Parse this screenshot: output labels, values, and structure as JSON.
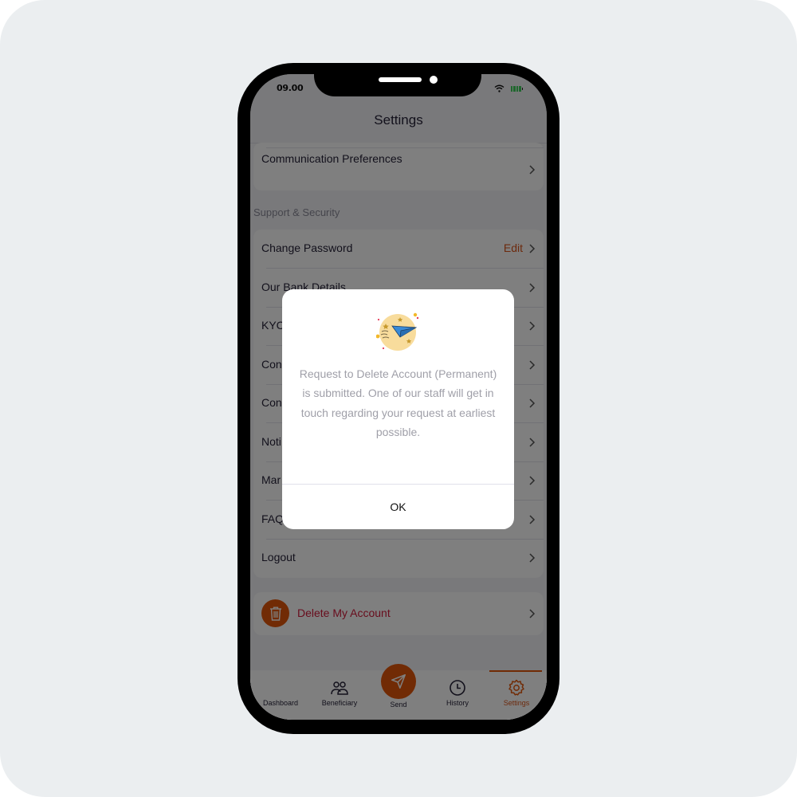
{
  "status_bar": {
    "time": "09.00",
    "wifi_icon": "wifi-icon",
    "battery_icon": "battery-icon"
  },
  "header": {
    "title": "Settings"
  },
  "account_section": {
    "items": [
      {
        "label": "Communication Preferences"
      }
    ]
  },
  "support_section": {
    "title": "Support & Security",
    "items": [
      {
        "label": "Change Password",
        "action": "Edit"
      },
      {
        "label": "Our Bank Details"
      },
      {
        "label": "KYC"
      },
      {
        "label": "Con"
      },
      {
        "label": "Con"
      },
      {
        "label": "Noti"
      },
      {
        "label": "Mar"
      },
      {
        "label": "FAQ"
      },
      {
        "label": "Logout"
      }
    ]
  },
  "delete_account": {
    "label": "Delete My Account",
    "icon": "trash-icon"
  },
  "bottom_nav": {
    "items": [
      {
        "label": "Dashboard",
        "icon": ""
      },
      {
        "label": "Beneficiary",
        "icon": "users-icon"
      },
      {
        "label": "Send",
        "icon": "paper-plane-icon"
      },
      {
        "label": "History",
        "icon": "clock-icon"
      },
      {
        "label": "Settings",
        "icon": "gear-icon",
        "active": true
      }
    ]
  },
  "modal": {
    "illustration": "paper-plane-illustration",
    "message": "Request to Delete Account (Permanent) is submitted. One of our staff will get in touch regarding your request at earliest possible.",
    "ok_label": "OK"
  },
  "colors": {
    "accent": "#e2570b",
    "danger_text": "#d01a3a",
    "text_primary": "#262339",
    "battery_green": "#3ecf5a"
  }
}
